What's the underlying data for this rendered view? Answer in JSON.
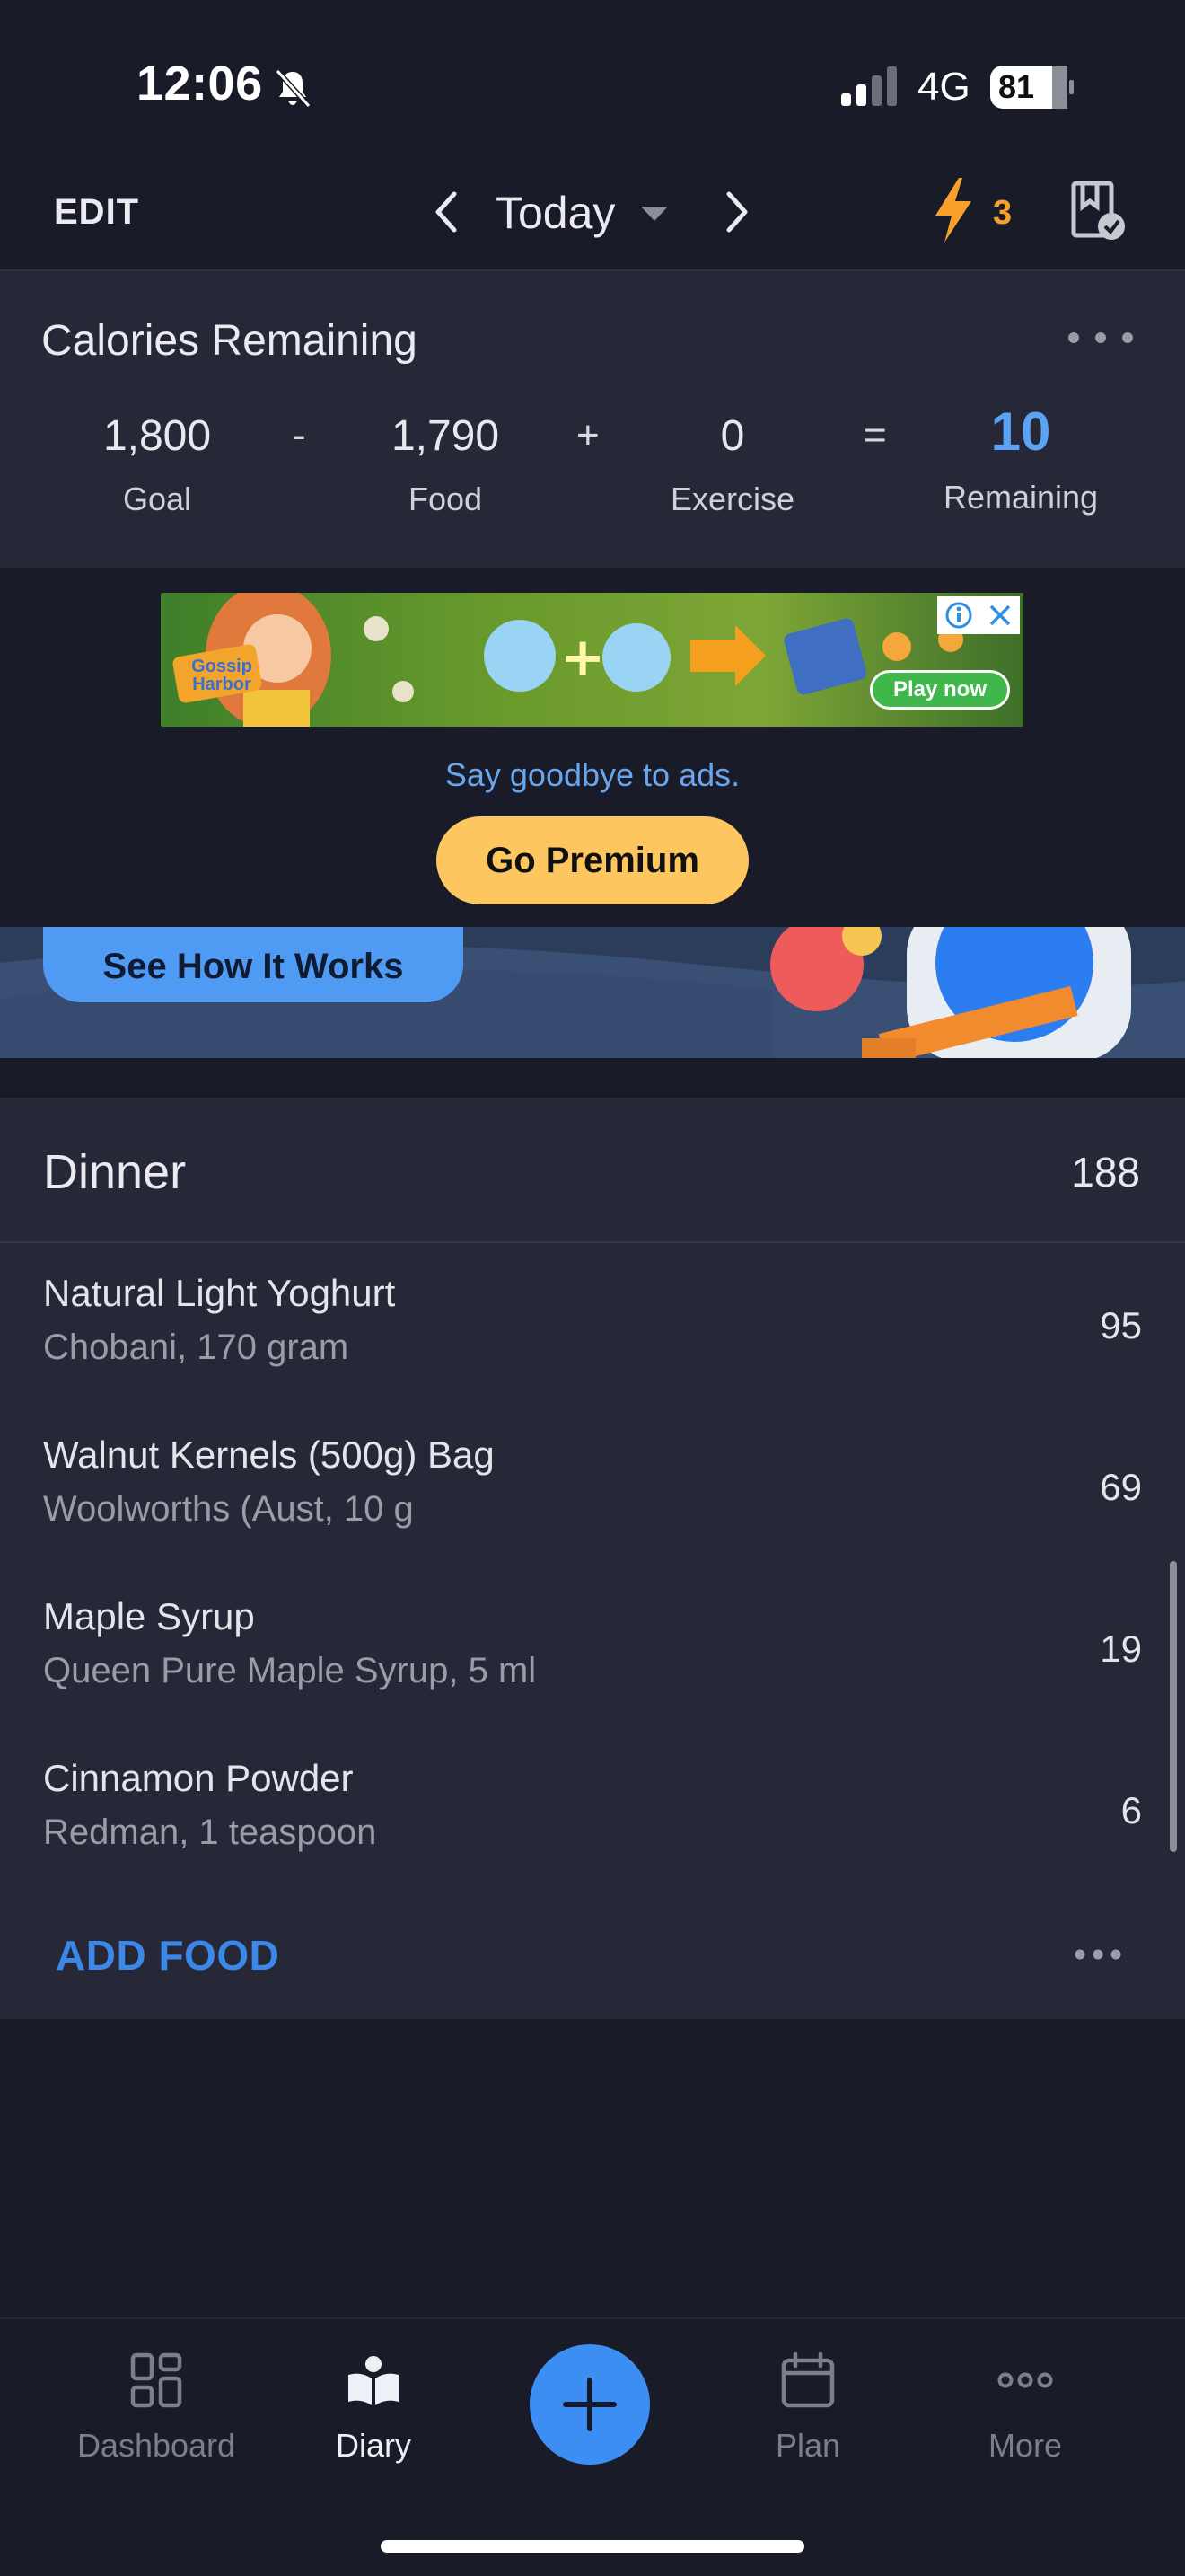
{
  "status": {
    "time": "12:06",
    "network": "4G",
    "battery": "81"
  },
  "header": {
    "edit": "EDIT",
    "date": "Today",
    "streak": "3"
  },
  "calories": {
    "title": "Calories Remaining",
    "goal": {
      "value": "1,800",
      "label": "Goal"
    },
    "op_minus": "-",
    "food": {
      "value": "1,790",
      "label": "Food"
    },
    "op_plus": "+",
    "exercise": {
      "value": "0",
      "label": "Exercise"
    },
    "op_equals": "=",
    "remaining": {
      "value": "10",
      "label": "Remaining"
    }
  },
  "ad": {
    "banner_logo": "Gossip Harbor",
    "banner_cta": "Play now",
    "goodbye_text": "Say goodbye to ads.",
    "premium_label": "Go Premium"
  },
  "promo": {
    "button_label": "See How It Works"
  },
  "dinner": {
    "title": "Dinner",
    "total": "188",
    "items": [
      {
        "name": "Natural Light Yoghurt",
        "detail": "Chobani, 170 gram",
        "calories": "95"
      },
      {
        "name": "Walnut Kernels (500g) Bag",
        "detail": "Woolworths (Aust, 10 g",
        "calories": "69"
      },
      {
        "name": "Maple Syrup",
        "detail": "Queen Pure Maple Syrup, 5 ml",
        "calories": "19"
      },
      {
        "name": "Cinnamon Powder",
        "detail": "Redman, 1 teaspoon",
        "calories": "6"
      }
    ],
    "add_food": "ADD FOOD"
  },
  "tabs": [
    {
      "label": "Dashboard",
      "icon": "grid-icon",
      "active": false
    },
    {
      "label": "Diary",
      "icon": "book-icon",
      "active": true
    },
    {
      "label": "",
      "icon": "plus-icon",
      "active": false
    },
    {
      "label": "Plan",
      "icon": "calendar-icon",
      "active": false
    },
    {
      "label": "More",
      "icon": "more-icon",
      "active": false
    }
  ],
  "colors": {
    "background": "#191b28",
    "card": "#262838",
    "accent_blue": "#3d8ef2",
    "remaining_blue": "#5aa3f5",
    "premium_yellow": "#fdc65e",
    "streak_orange": "#f7a12b"
  }
}
